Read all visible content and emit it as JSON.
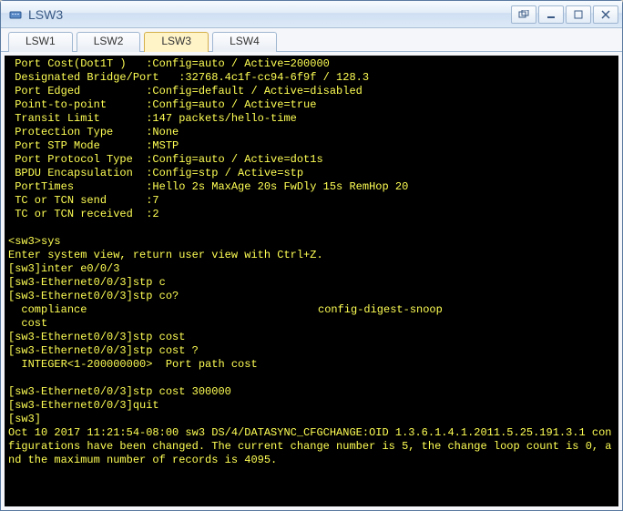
{
  "window": {
    "title": "LSW3"
  },
  "tabs": [
    {
      "label": "LSW1",
      "active": false
    },
    {
      "label": "LSW2",
      "active": false
    },
    {
      "label": "LSW3",
      "active": true
    },
    {
      "label": "LSW4",
      "active": false
    }
  ],
  "terminal": {
    "lines": [
      " Port Cost(Dot1T )   :Config=auto / Active=200000",
      " Designated Bridge/Port   :32768.4c1f-cc94-6f9f / 128.3",
      " Port Edged          :Config=default / Active=disabled",
      " Point-to-point      :Config=auto / Active=true",
      " Transit Limit       :147 packets/hello-time",
      " Protection Type     :None",
      " Port STP Mode       :MSTP",
      " Port Protocol Type  :Config=auto / Active=dot1s",
      " BPDU Encapsulation  :Config=stp / Active=stp",
      " PortTimes           :Hello 2s MaxAge 20s FwDly 15s RemHop 20",
      " TC or TCN send      :7",
      " TC or TCN received  :2",
      "",
      "<sw3>sys",
      "Enter system view, return user view with Ctrl+Z.",
      "[sw3]inter e0/0/3",
      "[sw3-Ethernet0/0/3]stp c",
      "[sw3-Ethernet0/0/3]stp co?"
    ],
    "twocol": {
      "c1": "  compliance",
      "c2": "config-digest-snoop"
    },
    "lines2": [
      "  cost",
      "[sw3-Ethernet0/0/3]stp cost",
      "[sw3-Ethernet0/0/3]stp cost ?",
      "  INTEGER<1-200000000>  Port path cost",
      "",
      "[sw3-Ethernet0/0/3]stp cost 300000",
      "[sw3-Ethernet0/0/3]quit",
      "[sw3]",
      "Oct 10 2017 11:21:54-08:00 sw3 DS/4/DATASYNC_CFGCHANGE:OID 1.3.6.1.4.1.2011.5.25.191.3.1 configurations have been changed. The current change number is 5, the change loop count is 0, and the maximum number of records is 4095.",
      ""
    ]
  }
}
